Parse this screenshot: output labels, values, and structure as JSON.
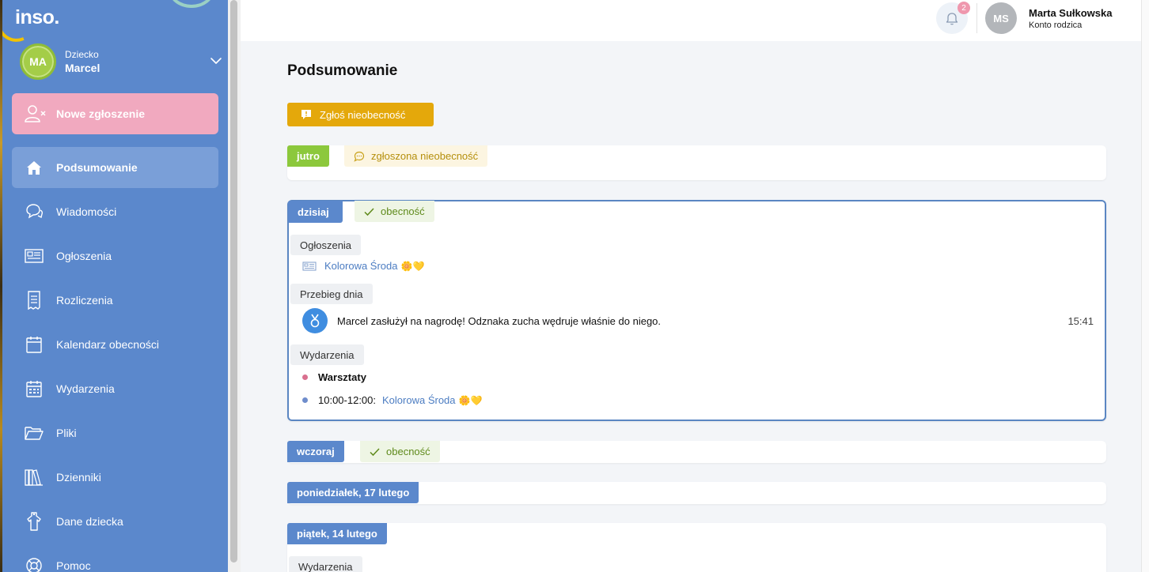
{
  "brand": {
    "logo": "inso."
  },
  "child": {
    "initials": "MA",
    "label": "Dziecko",
    "name": "Marcel"
  },
  "sidebar": {
    "new_request": "Nowe zgłoszenie",
    "items": [
      {
        "label": "Podsumowanie",
        "icon": "home-icon",
        "active": true
      },
      {
        "label": "Wiadomości",
        "icon": "chat-icon"
      },
      {
        "label": "Ogłoszenia",
        "icon": "newspaper-icon"
      },
      {
        "label": "Rozliczenia",
        "icon": "receipt-icon"
      },
      {
        "label": "Kalendarz obecności",
        "icon": "calendar-icon"
      },
      {
        "label": "Wydarzenia",
        "icon": "calendar-grid-icon"
      },
      {
        "label": "Pliki",
        "icon": "folder-icon"
      },
      {
        "label": "Dzienniki",
        "icon": "books-icon"
      },
      {
        "label": "Dane dziecka",
        "icon": "shirt-icon"
      },
      {
        "label": "Pomoc",
        "icon": "lifebuoy-icon"
      }
    ]
  },
  "header": {
    "notifications_count": "2",
    "user_initials": "MS",
    "user_name": "Marta Sułkowska",
    "user_role": "Konto rodzica"
  },
  "main": {
    "title": "Podsumowanie",
    "report_absence": "Zgłoś nieobecność",
    "days": {
      "tomorrow": {
        "tag": "jutro",
        "status": "zgłoszona nieobecność"
      },
      "today": {
        "tag": "dzisiaj",
        "status": "obecność",
        "announcements_label": "Ogłoszenia",
        "announcement_link": "Kolorowa Środa",
        "announcement_emoji": "🌼💛",
        "timeline_label": "Przebieg dnia",
        "timeline_text": "Marcel zasłużył na nagrodę! Odznaka zucha wędruje właśnie do niego.",
        "timeline_time": "15:41",
        "events_label": "Wydarzenia",
        "event1": "Warsztaty",
        "event2_time": "10:00-12:00:",
        "event2_link": "Kolorowa Środa",
        "event2_emoji": "🌼💛"
      },
      "yesterday": {
        "tag": "wczoraj",
        "status": "obecność"
      },
      "monday": {
        "tag": "poniedziałek, 17 lutego"
      },
      "friday": {
        "tag": "piątek, 14 lutego",
        "events_label": "Wydarzenia"
      }
    }
  },
  "colors": {
    "sidebar": "#5b88cc",
    "new_request": "#f1a9bf",
    "report_button": "#e4a80b",
    "tag_green": "#8cc83c",
    "tag_blue": "#5b88cc",
    "today_border": "#5a86c2",
    "event_dot_pink": "#d9708f",
    "event_dot_blue": "#6f8dcc"
  }
}
